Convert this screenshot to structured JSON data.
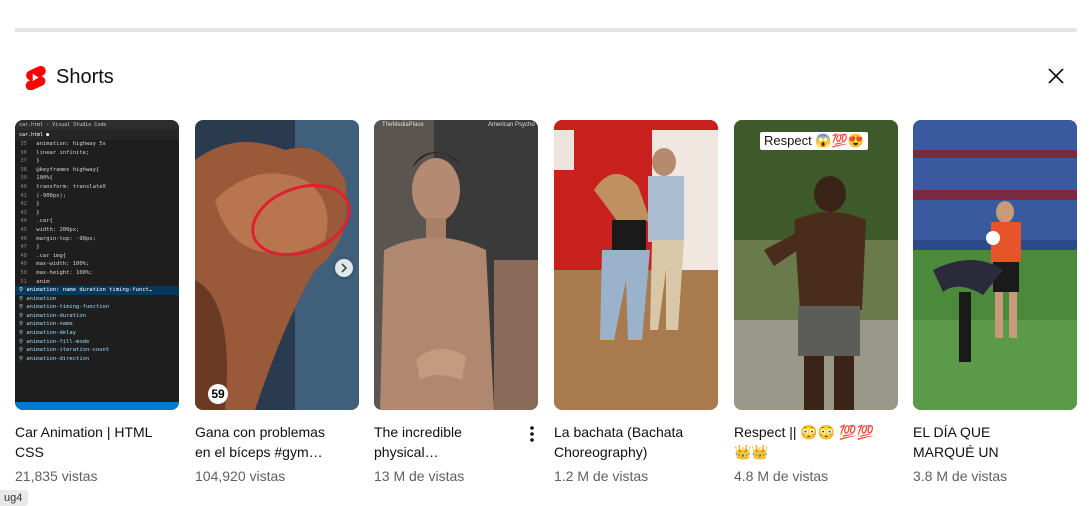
{
  "section": {
    "title": "Shorts",
    "icon": "youtube-shorts-icon",
    "close_icon": "close-icon"
  },
  "shorts": [
    {
      "title": "Car Animation | HTML CSS",
      "views": "21,835 vistas"
    },
    {
      "title": "Gana con problemas en el bíceps #gym…",
      "views": "104,920 vistas"
    },
    {
      "title": "The incredible physical…",
      "views": "13 M de vistas"
    },
    {
      "title": "La bachata (Bachata Choreography)",
      "views": "1.2 M de vistas"
    },
    {
      "title": "Respect || 😳😳 💯💯👑👑",
      "views": "4.8 M de vistas"
    },
    {
      "title": "EL DÍA QUE MARQUÉ UN GOLAZO EN EL…",
      "views": "3.8 M de vistas"
    }
  ],
  "thumb_text": {
    "vscode_tab": "car.html - Visual Studio Code",
    "respect_overlay": "Respect 😱💯😍",
    "badge_number": "59",
    "watermark_left": "TheMediaPlace",
    "watermark_right": "American Psycho"
  },
  "code_lines": [
    {
      "n": "35",
      "t": "    animation: highway 5s"
    },
    {
      "n": "36",
      "t": "      linear infinite;"
    },
    {
      "n": "37",
      "t": "  }"
    },
    {
      "n": "38",
      "t": "  @keyframes highway{"
    },
    {
      "n": "39",
      "t": "    100%{"
    },
    {
      "n": "40",
      "t": "      transform: translateX"
    },
    {
      "n": "41",
      "t": "      (-900px);"
    },
    {
      "n": "42",
      "t": "    }"
    },
    {
      "n": "43",
      "t": "  }"
    },
    {
      "n": "44",
      "t": "  .car{"
    },
    {
      "n": "45",
      "t": "    width: 200px;"
    },
    {
      "n": "46",
      "t": "    margin-top: -90px;"
    },
    {
      "n": "47",
      "t": "  }"
    },
    {
      "n": "48",
      "t": "  .car img{"
    },
    {
      "n": "49",
      "t": "    max-width: 100%;"
    },
    {
      "n": "50",
      "t": "    max-height: 100%;"
    },
    {
      "n": "51",
      "t": "    anim"
    }
  ],
  "suggestions": [
    "animation: name duration timing-funct…",
    "animation",
    "animation-timing-function",
    "animation-duration",
    "animation-name",
    "animation-delay",
    "animation-fill-mode",
    "animation-iteration-count",
    "animation-direction"
  ],
  "corner_tag": "ug4",
  "colors": {
    "shorts_red": "#ff0000",
    "divider": "#e5e5e5",
    "secondary_text": "#606060"
  }
}
